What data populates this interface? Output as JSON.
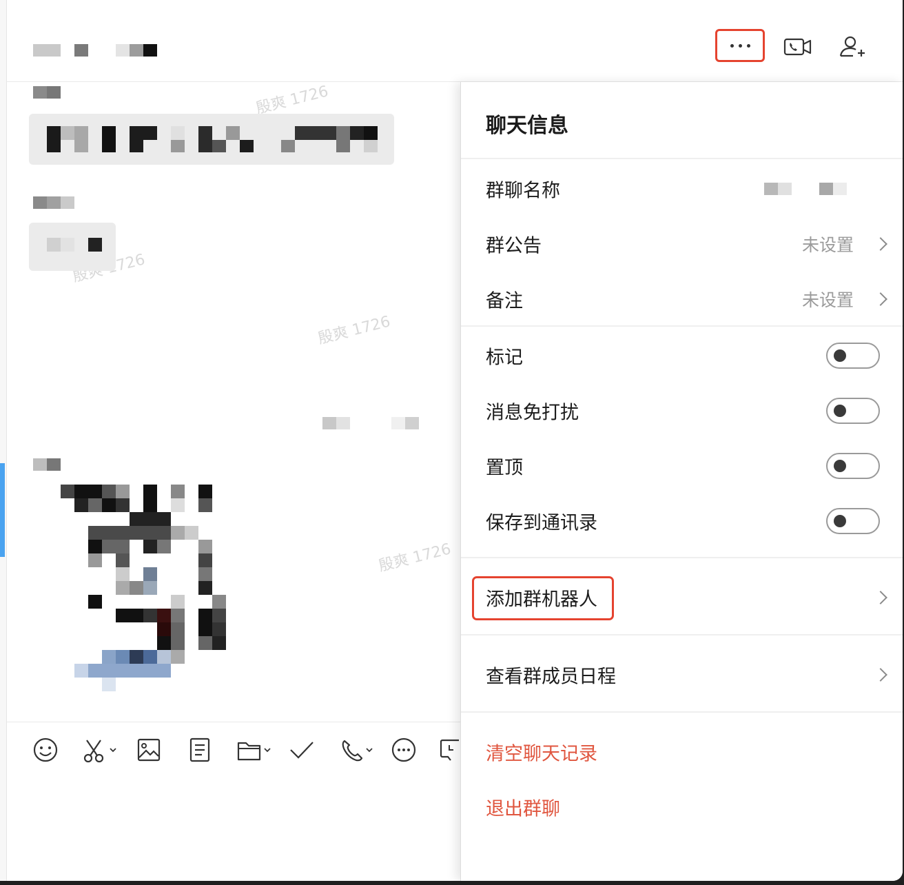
{
  "watermark": "殷爽 1726",
  "panel": {
    "title": "聊天信息",
    "group_name_label": "群聊名称",
    "announcement_label": "群公告",
    "announcement_value": "未设置",
    "remark_label": "备注",
    "remark_value": "未设置",
    "mark_label": "标记",
    "mute_label": "消息免打扰",
    "pin_label": "置顶",
    "save_contacts_label": "保存到通讯录",
    "add_bot_label": "添加群机器人",
    "schedule_label": "查看群成员日程",
    "clear_history_label": "清空聊天记录",
    "leave_group_label": "退出群聊"
  },
  "toggles": {
    "mark": false,
    "mute": false,
    "pin": false,
    "save_contacts": false
  },
  "colors": {
    "highlight": "#e5432f",
    "danger_text": "#e0563f",
    "accent_blue": "#4aa3f0"
  },
  "icons": [
    "more-icon",
    "video-call-icon",
    "add-member-icon",
    "emoji-icon",
    "scissors-icon",
    "image-icon",
    "document-icon",
    "folder-icon",
    "check-icon",
    "phone-icon",
    "more-circle-icon",
    "schedule-icon"
  ]
}
